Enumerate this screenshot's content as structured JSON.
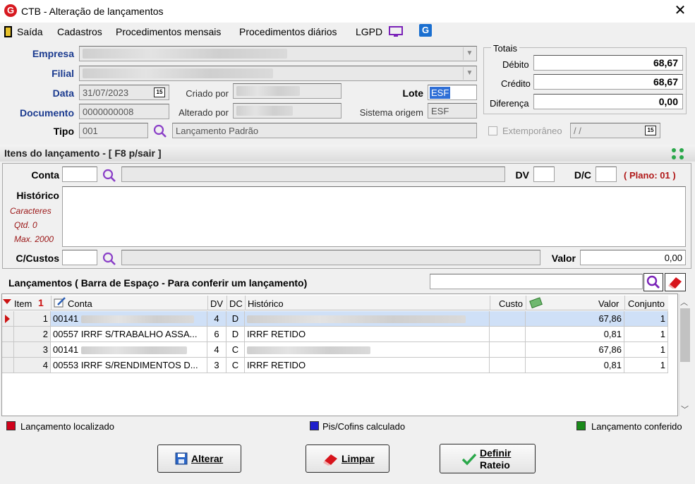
{
  "window": {
    "title": "CTB - Alteração de lançamentos",
    "logo": "G"
  },
  "menu": {
    "items": [
      "Saída",
      "Cadastros",
      "Procedimentos mensais",
      "Procedimentos diários",
      "LGPD"
    ]
  },
  "form": {
    "empresa_label": "Empresa",
    "filial_label": "Filial",
    "data_label": "Data",
    "data_value": "31/07/2023",
    "criado_label": "Criado por",
    "lote_label": "Lote",
    "lote_value": "ESF",
    "documento_label": "Documento",
    "documento_value": "0000000008",
    "alterado_label": "Alterado por",
    "sistema_label": "Sistema origem",
    "sistema_value": "ESF",
    "tipo_label": "Tipo",
    "tipo_code": "001",
    "tipo_desc": "Lançamento Padrão",
    "calendar_icon_text": "15"
  },
  "totais": {
    "legend": "Totais",
    "debito_label": "Débito",
    "debito_value": "68,67",
    "credito_label": "Crédito",
    "credito_value": "68,67",
    "diferenca_label": "Diferença",
    "diferenca_value": "0,00",
    "extemporaneo_label": "Extemporâneo",
    "extemporaneo_date": " /  /"
  },
  "itens": {
    "header": "Itens do lançamento - [ F8 p/sair ]",
    "conta_label": "Conta",
    "dv_label": "DV",
    "dc_label": "D/C",
    "plano": "( Plano: 01 )",
    "historico_label": "Histórico",
    "caracteres": "Caracteres",
    "qtd": "Qtd. 0",
    "max": "Max. 2000",
    "ccustos_label": "C/Custos",
    "valor_label": "Valor",
    "valor_value": "0,00"
  },
  "lancamentos": {
    "header": "Lançamentos ( Barra de Espaço - Para conferir um lançamento)",
    "columns": [
      "Item",
      "Conta",
      "DV",
      "DC",
      "Histórico",
      "Custo",
      "Valor",
      "Conjunto"
    ],
    "rows": [
      {
        "item": "1",
        "conta": "00141",
        "dv": "4",
        "dc": "D",
        "historico": "",
        "custo": "",
        "valor": "67,86",
        "conjunto": "1"
      },
      {
        "item": "2",
        "conta": "00557 IRRF S/TRABALHO ASSA...",
        "dv": "6",
        "dc": "D",
        "historico": "IRRF RETIDO",
        "custo": "",
        "valor": "0,81",
        "conjunto": "1"
      },
      {
        "item": "3",
        "conta": "00141",
        "dv": "4",
        "dc": "C",
        "historico": "",
        "custo": "",
        "valor": "67,86",
        "conjunto": "1"
      },
      {
        "item": "4",
        "conta": "00553 IRRF S/RENDIMENTOS D...",
        "dv": "3",
        "dc": "C",
        "historico": "IRRF RETIDO",
        "custo": "",
        "valor": "0,81",
        "conjunto": "1"
      }
    ]
  },
  "legend": {
    "localizado": "Lançamento localizado",
    "piscofins": "Pis/Cofins calculado",
    "conferido": "Lançamento conferido",
    "colors": {
      "localizado": "#d0021b",
      "piscofins": "#1f1fcc",
      "conferido": "#1a8a1a"
    }
  },
  "buttons": {
    "alterar": "Alterar",
    "limpar": "Limpar",
    "definir1": "Definir",
    "definir2": "Rateio"
  }
}
